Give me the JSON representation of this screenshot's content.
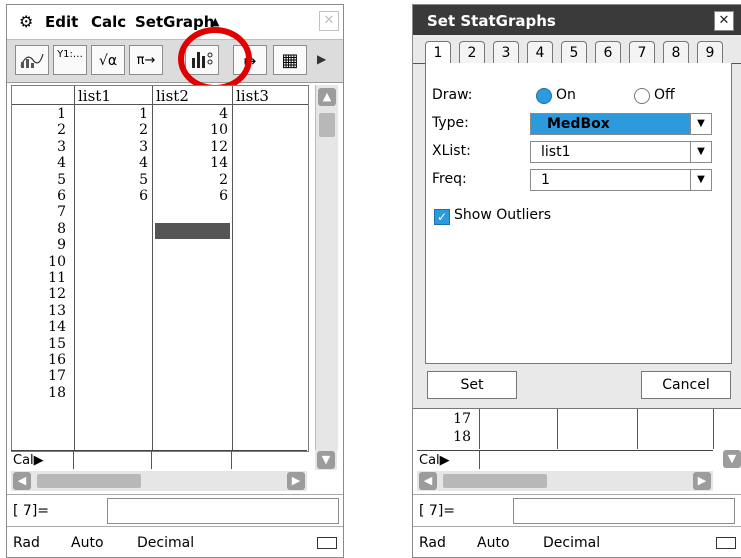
{
  "left": {
    "menu": {
      "gear_icon": "gear-icon",
      "items": [
        "Edit",
        "Calc",
        "SetGraph"
      ]
    },
    "toolbar": {
      "buttons": [
        {
          "icon": "graph-icon",
          "label": ""
        },
        {
          "icon": "y-list-icon",
          "label": "Y1:…"
        },
        {
          "icon": "sqrt-alpha-icon",
          "label": "√α"
        },
        {
          "icon": "pi-icon",
          "label": "π→"
        },
        {
          "icon": "stat-graph-icon",
          "label": ""
        },
        {
          "icon": "arrow-icon",
          "label": "↦"
        },
        {
          "icon": "table-icon",
          "label": "▦"
        },
        {
          "icon": "more-icon",
          "label": "▶"
        }
      ]
    },
    "table": {
      "headers": [
        "list1",
        "list2",
        "list3"
      ],
      "row_numbers": [
        "1",
        "2",
        "3",
        "4",
        "5",
        "6",
        "7",
        "8",
        "9",
        "10",
        "11",
        "12",
        "13",
        "14",
        "15",
        "16",
        "17",
        "18"
      ],
      "list1": [
        "1",
        "2",
        "3",
        "4",
        "5",
        "6"
      ],
      "list2": [
        "4",
        "10",
        "12",
        "14",
        "2",
        "6"
      ],
      "cal_label": "Cal▶"
    },
    "entry_label": "[ 7]=",
    "status": {
      "angle": "Rad",
      "mode": "Auto",
      "format": "Decimal"
    }
  },
  "right": {
    "dialog": {
      "title": "Set StatGraphs",
      "close": "✕",
      "tabs": [
        "1",
        "2",
        "3",
        "4",
        "5",
        "6",
        "7",
        "8",
        "9"
      ],
      "draw_label": "Draw:",
      "on_label": "On",
      "off_label": "Off",
      "type_label": "Type:",
      "type_value": "MedBox",
      "xlist_label": "XList:",
      "xlist_value": "list1",
      "freq_label": "Freq:",
      "freq_value": "1",
      "show_outliers_label": "Show Outliers",
      "set_button": "Set",
      "cancel_button": "Cancel"
    },
    "table": {
      "row_numbers": [
        "17",
        "18"
      ],
      "cal_label": "Cal▶"
    },
    "entry_label": "[ 7]=",
    "status": {
      "angle": "Rad",
      "mode": "Auto",
      "format": "Decimal"
    }
  }
}
